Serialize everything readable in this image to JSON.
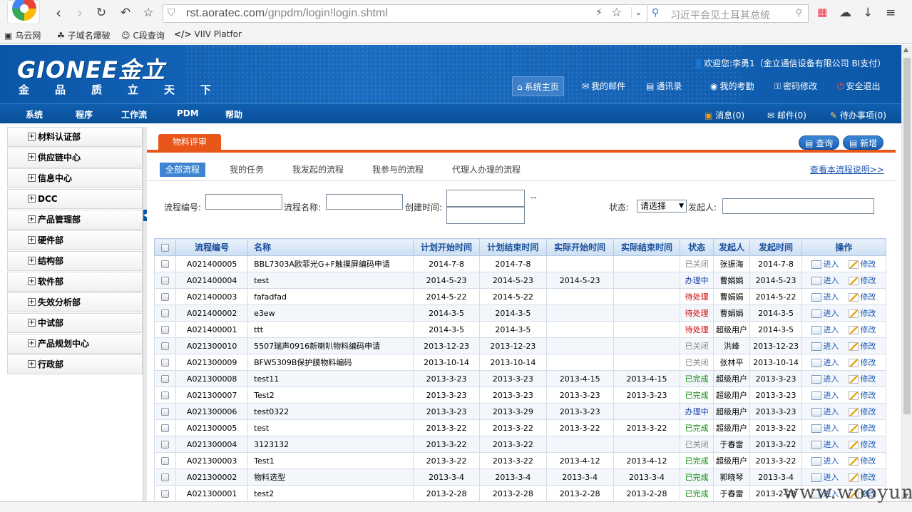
{
  "browser": {
    "url_host": "rst.aoratec.com",
    "url_path": "/gnpdm/login!login.shtml",
    "search_placeholder": "习近平会见土耳其总统",
    "bookmarks": [
      "乌云网",
      "子域名爆破",
      "C段查询",
      "VIIV Platfor"
    ]
  },
  "header": {
    "brand": "GIONEE金立",
    "slogan": "金品质立天下",
    "welcome": "欢迎您:李勇1（金立通信设备有限公司 BI支付）",
    "nav": [
      {
        "label": "系统主页",
        "icon": "home-icon"
      },
      {
        "label": "我的邮件",
        "icon": "mail-icon"
      },
      {
        "label": "通讯录",
        "icon": "address-book-icon"
      },
      {
        "label": "我的考勤",
        "icon": "clock-icon"
      },
      {
        "label": "密码修改",
        "icon": "key-icon"
      },
      {
        "label": "安全退出",
        "icon": "logout-icon"
      }
    ]
  },
  "menu": {
    "items": [
      "系统",
      "程序",
      "工作流",
      "PDM",
      "帮助"
    ],
    "right": [
      {
        "label": "消息(0)",
        "icon": "rss-icon"
      },
      {
        "label": "邮件(0)",
        "icon": "envelope-icon"
      },
      {
        "label": "待办事项(0)",
        "icon": "todo-icon"
      }
    ]
  },
  "sidebar": {
    "items": [
      "材料认证部",
      "供应链中心",
      "信息中心",
      "DCC",
      "产品管理部",
      "硬件部",
      "结构部",
      "软件部",
      "失效分析部",
      "中试部",
      "产品规划中心",
      "行政部"
    ]
  },
  "main": {
    "tab": "物料评审",
    "buttons": {
      "query": "查询",
      "add": "新增"
    },
    "subtabs": [
      "全部流程",
      "我的任务",
      "我发起的流程",
      "我参与的流程",
      "代理人办理的流程"
    ],
    "help_link": "查看本流程说明>>",
    "filters": {
      "code_label": "流程编号:",
      "name_label": "流程名称:",
      "created_label": "创建时间:",
      "range_sep": "--",
      "status_label": "状态:",
      "status_value": "请选择",
      "initiator_label": "发起人:"
    }
  },
  "table": {
    "headers": [
      "流程编号",
      "名称",
      "计划开始时间",
      "计划结束时间",
      "实际开始时间",
      "实际结束时间",
      "状态",
      "发起人",
      "发起时间",
      "操作"
    ],
    "action_enter": "进入",
    "action_edit": "修改",
    "rows": [
      {
        "code": "A021400005",
        "name": "BBL7303A欧菲光G+F触摸屏编码申请",
        "ps": "2014-7-8",
        "pe": "2014-7-8",
        "as": "",
        "ae": "",
        "status": "已关闭",
        "stype": "closed",
        "by": "张振海",
        "at": "2014-7-8"
      },
      {
        "code": "A021400004",
        "name": "test",
        "ps": "2014-5-23",
        "pe": "2014-5-23",
        "as": "2014-5-23",
        "ae": "",
        "status": "办理中",
        "stype": "doing",
        "by": "曹娟娟",
        "at": "2014-5-23"
      },
      {
        "code": "A021400003",
        "name": "fafadfad",
        "ps": "2014-5-22",
        "pe": "2014-5-22",
        "as": "",
        "ae": "",
        "status": "待处理",
        "stype": "pending",
        "by": "曹娟娟",
        "at": "2014-5-22"
      },
      {
        "code": "A021400002",
        "name": "e3ew",
        "ps": "2014-3-5",
        "pe": "2014-3-5",
        "as": "",
        "ae": "",
        "status": "待处理",
        "stype": "pending",
        "by": "曹娟娟",
        "at": "2014-3-5"
      },
      {
        "code": "A021400001",
        "name": "ttt",
        "ps": "2014-3-5",
        "pe": "2014-3-5",
        "as": "",
        "ae": "",
        "status": "待处理",
        "stype": "pending",
        "by": "超级用户",
        "at": "2014-3-5"
      },
      {
        "code": "A021300010",
        "name": "5507瑞声0916新喇叭物料编码申请",
        "ps": "2013-12-23",
        "pe": "2013-12-23",
        "as": "",
        "ae": "",
        "status": "已关闭",
        "stype": "closed",
        "by": "洪峰",
        "at": "2013-12-23"
      },
      {
        "code": "A021300009",
        "name": "BFW5309B保护膜物料编码",
        "ps": "2013-10-14",
        "pe": "2013-10-14",
        "as": "",
        "ae": "",
        "status": "已关闭",
        "stype": "closed",
        "by": "张林平",
        "at": "2013-10-14"
      },
      {
        "code": "A021300008",
        "name": "test11",
        "ps": "2013-3-23",
        "pe": "2013-3-23",
        "as": "2013-4-15",
        "ae": "2013-4-15",
        "status": "已完成",
        "stype": "done",
        "by": "超级用户",
        "at": "2013-3-23"
      },
      {
        "code": "A021300007",
        "name": "Test2",
        "ps": "2013-3-23",
        "pe": "2013-3-23",
        "as": "2013-3-23",
        "ae": "2013-3-23",
        "status": "已完成",
        "stype": "done",
        "by": "超级用户",
        "at": "2013-3-23"
      },
      {
        "code": "A021300006",
        "name": "test0322",
        "ps": "2013-3-23",
        "pe": "2013-3-29",
        "as": "2013-3-23",
        "ae": "",
        "status": "办理中",
        "stype": "doing",
        "by": "超级用户",
        "at": "2013-3-23"
      },
      {
        "code": "A021300005",
        "name": "test",
        "ps": "2013-3-22",
        "pe": "2013-3-22",
        "as": "2013-3-22",
        "ae": "2013-3-22",
        "status": "已完成",
        "stype": "done",
        "by": "超级用户",
        "at": "2013-3-22"
      },
      {
        "code": "A021300004",
        "name": "3123132",
        "ps": "2013-3-22",
        "pe": "2013-3-22",
        "as": "",
        "ae": "",
        "status": "已关闭",
        "stype": "closed",
        "by": "于春雷",
        "at": "2013-3-22"
      },
      {
        "code": "A021300003",
        "name": "Test1",
        "ps": "2013-3-22",
        "pe": "2013-3-22",
        "as": "2013-4-12",
        "ae": "2013-4-12",
        "status": "已完成",
        "stype": "done",
        "by": "超级用户",
        "at": "2013-3-22"
      },
      {
        "code": "A021300002",
        "name": "物料选型",
        "ps": "2013-3-4",
        "pe": "2013-3-4",
        "as": "2013-3-4",
        "ae": "2013-3-4",
        "status": "已完成",
        "stype": "done",
        "by": "郭晓琴",
        "at": "2013-3-4"
      },
      {
        "code": "A021300001",
        "name": "test2",
        "ps": "2013-2-28",
        "pe": "2013-2-28",
        "as": "2013-2-28",
        "ae": "2013-2-28",
        "status": "已完成",
        "stype": "done",
        "by": "于春雷",
        "at": "2013-2-28"
      }
    ]
  },
  "watermark": "www.wooyun.org",
  "colors": {
    "header_blue": "#1563b6",
    "accent_orange": "#e8561a",
    "link_blue": "#1a55b0"
  }
}
